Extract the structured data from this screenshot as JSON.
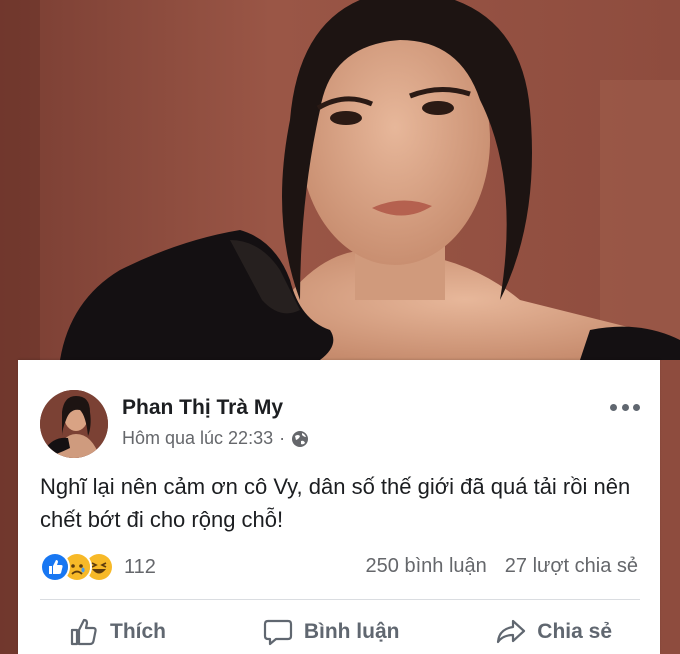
{
  "post": {
    "author_name": "Phan Thị Trà My",
    "timestamp": "Hôm qua lúc 22:33",
    "separator": "·",
    "privacy_icon": "globe-icon",
    "text": "Nghĩ lại nên cảm ơn cô Vy, dân số thế giới đã quá tải rồi nên chết bớt đi cho rộng chỗ!",
    "reaction_icons": [
      "like-icon",
      "sad-icon",
      "haha-icon"
    ],
    "reaction_count": "112",
    "comments": "250 bình luận",
    "shares": "27 lượt chia sẻ"
  },
  "actions": {
    "like_label": "Thích",
    "comment_label": "Bình luận",
    "share_label": "Chia sẻ"
  },
  "colors": {
    "card_bg": "#ffffff",
    "text": "#1c1e21",
    "secondary": "#65676b",
    "like_blue": "#1877f2",
    "emoji_yellow": "#f7b928"
  }
}
